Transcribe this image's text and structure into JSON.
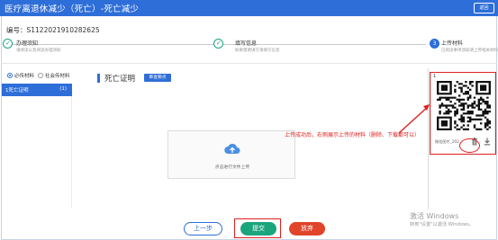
{
  "header": {
    "title": "医疗离退休减少（死亡）-死亡减少",
    "button_label": "返回"
  },
  "order": {
    "label": "编号：",
    "value": "S1122021910282625"
  },
  "steps": [
    {
      "title": "办理须知",
      "desc": "请阅读以及阅读办理须知",
      "state": "done"
    },
    {
      "title": "填写信息",
      "desc": "如果需要填写请填写信息",
      "state": "done"
    },
    {
      "number": "3",
      "title": "上传材料",
      "desc": "已阅读事项须知请上传相关材料",
      "state": "active"
    }
  ],
  "filters": {
    "required": "必传材料",
    "social": "社会传材料"
  },
  "sidebar": {
    "items": [
      {
        "label": "1死亡证明",
        "count": "(1)"
      }
    ]
  },
  "document": {
    "title": "死亡证明",
    "badge": "审查要点"
  },
  "upload": {
    "text": "点击进行文件上传"
  },
  "file_card": {
    "index": "1",
    "name": "微信图片_202..."
  },
  "annotation": "上传成功后，右侧展示上传的材料（删除、下载都可以）",
  "buttons": {
    "prev": "上一步",
    "submit": "提交",
    "abandon": "放弃"
  },
  "watermark": {
    "line1": "激活 Windows",
    "line2": "转到\"设置\"以激活 Windows。"
  },
  "colors": {
    "primary": "#2e6ed8",
    "success": "#1aa57c",
    "danger": "#e0452b",
    "annotation": "#e02020"
  }
}
